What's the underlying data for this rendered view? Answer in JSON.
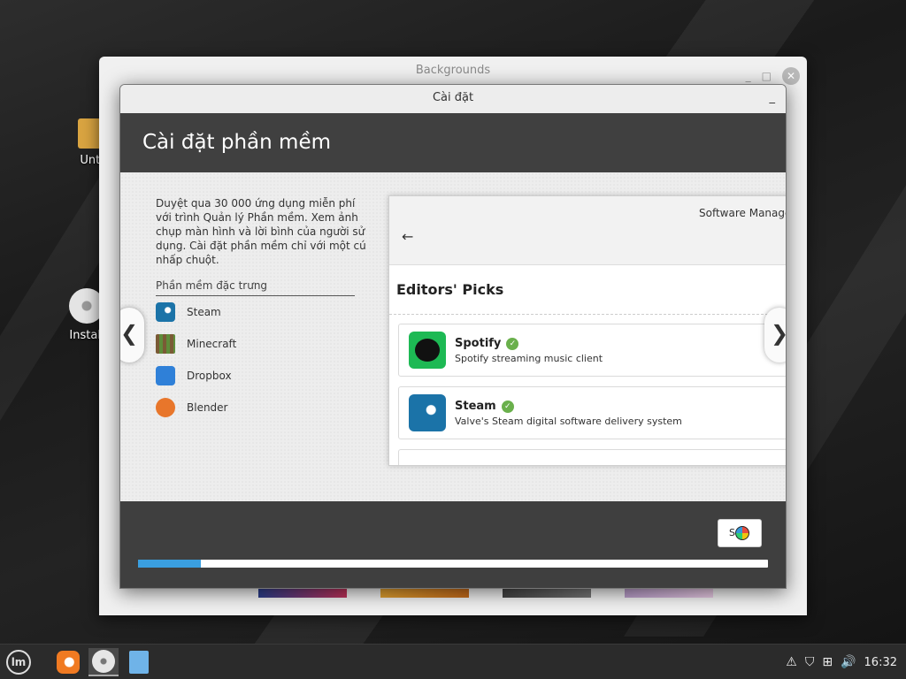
{
  "desktop": {
    "icons": [
      {
        "label": "Untitl"
      },
      {
        "label": "Install"
      }
    ]
  },
  "background_window": {
    "title": "Backgrounds",
    "minimize": "_",
    "maximize": "□",
    "close": "✕"
  },
  "dialog": {
    "title": "Cài đặt",
    "minimize": "_",
    "header": "Cài đặt phần mềm",
    "description": "Duyệt qua 30 000 ứng dụng miễn phí với trình Quản lý Phần mềm. Xem ảnh chụp màn hình và lời bình của người sử dụng. Cài đặt phần mềm chỉ với một cú nhấp chuột.",
    "featured_title": "Phần mềm đặc trưng",
    "featured_apps": [
      {
        "name": "Steam",
        "icon": "steam-icon"
      },
      {
        "name": "Minecraft",
        "icon": "minecraft-icon"
      },
      {
        "name": "Dropbox",
        "icon": "dropbox-icon"
      },
      {
        "name": "Blender",
        "icon": "blender-icon"
      }
    ],
    "nav_prev": "❮",
    "nav_next": "❯",
    "screenshot": {
      "window_title": "Software Manager",
      "back": "←",
      "section": "Editors' Picks",
      "picks": [
        {
          "name": "Spotify",
          "desc": "Spotify streaming music client",
          "verified": "✓"
        },
        {
          "name": "Steam",
          "desc": "Valve's Steam digital software delivery system",
          "verified": "✓"
        }
      ]
    },
    "progress_percent": 10,
    "footer_button_text": "S"
  },
  "taskbar": {
    "clock": "16:32"
  }
}
